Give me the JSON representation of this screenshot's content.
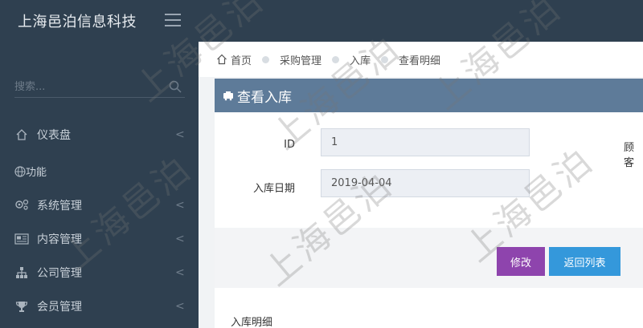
{
  "app": {
    "brand": "上海邑泊信息科技"
  },
  "sidebar": {
    "search_placeholder": "搜索...",
    "items": [
      {
        "label": "仪表盘",
        "chevron": "<"
      },
      {
        "label": "功能"
      },
      {
        "label": "系统管理",
        "chevron": "<"
      },
      {
        "label": "内容管理",
        "chevron": "<"
      },
      {
        "label": "公司管理",
        "chevron": "<"
      },
      {
        "label": "会员管理",
        "chevron": "<"
      }
    ]
  },
  "breadcrumb": [
    "首页",
    "采购管理",
    "入库",
    "查看明细"
  ],
  "panel": {
    "title": "查看入库",
    "fields": [
      {
        "label": "ID",
        "value": "1"
      },
      {
        "label": "入库日期",
        "value": "2019-04-04"
      }
    ],
    "truncated_label": "顾客"
  },
  "actions": {
    "edit": "修改",
    "back": "返回列表"
  },
  "detail_section": {
    "title": "入库明细"
  },
  "watermark": "上海邑泊",
  "colors": {
    "header_bg": "#2f4050",
    "panel_head": "#5e7b99",
    "edit_button": "#8e44ad",
    "back_button": "#3498db"
  }
}
